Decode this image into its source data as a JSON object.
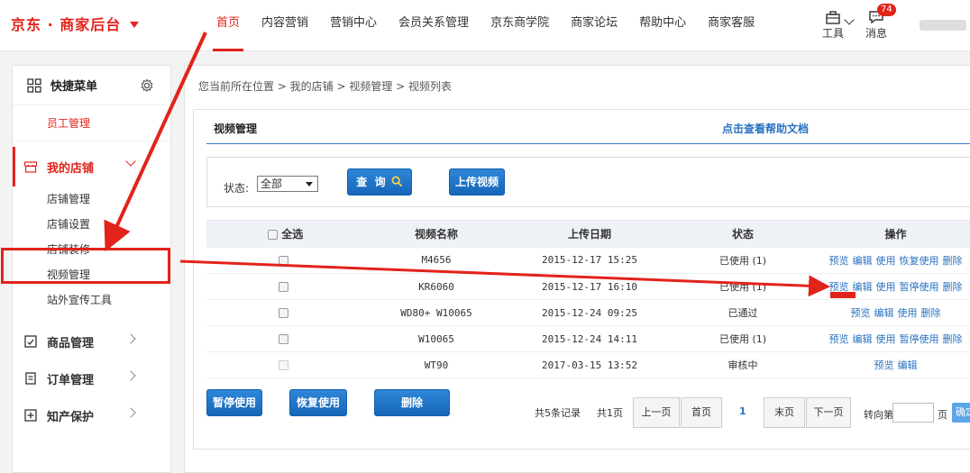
{
  "header": {
    "brand": "京东 · 商家后台",
    "nav": [
      "首页",
      "内容营销",
      "营销中心",
      "会员关系管理",
      "京东商学院",
      "商家论坛",
      "帮助中心",
      "商家客服"
    ],
    "active_nav_index": 0,
    "tools_label": "工具",
    "messages_label": "消息",
    "messages_count": "74"
  },
  "sidebar": {
    "quick_menu": "快捷菜单",
    "staff": "员工管理",
    "my_shop": "我的店铺",
    "shop_items": [
      "店铺管理",
      "店铺设置",
      "店铺装修",
      "视频管理",
      "站外宣传工具"
    ],
    "selected_item": "视频管理",
    "groups": [
      "商品管理",
      "订单管理",
      "知产保护"
    ]
  },
  "breadcrumb": "您当前所在位置 > 我的店铺 > 视频管理 > 视频列表",
  "panel": {
    "title": "视频管理",
    "help_link": "点击查看帮助文档",
    "status_label": "状态:",
    "status_value": "全部",
    "query_button": "查  询",
    "upload_button": "上传视频"
  },
  "table": {
    "select_all": "全选",
    "headers": [
      "视频名称",
      "上传日期",
      "状态",
      "操作"
    ],
    "rows": [
      {
        "name": "M4656",
        "date": "2015-12-17 15:25",
        "status": "已使用 (1)",
        "ops": [
          "预览",
          "编辑",
          "使用",
          "恢复使用",
          "删除"
        ],
        "disabled": false
      },
      {
        "name": "KR6060",
        "date": "2015-12-17 16:10",
        "status": "已使用 (1)",
        "ops": [
          "预览",
          "编辑",
          "使用",
          "暂停使用",
          "删除"
        ],
        "disabled": false
      },
      {
        "name": "WD80+ W10065",
        "date": "2015-12-24 09:25",
        "status": "已通过",
        "ops": [
          "预览",
          "编辑",
          "使用",
          "删除"
        ],
        "disabled": false
      },
      {
        "name": "W10065",
        "date": "2015-12-24 14:11",
        "status": "已使用 (1)",
        "ops": [
          "预览",
          "编辑",
          "使用",
          "暂停使用",
          "删除"
        ],
        "disabled": false
      },
      {
        "name": "WT90",
        "date": "2017-03-15 13:52",
        "status": "审核中",
        "ops": [
          "预览",
          "编辑"
        ],
        "disabled": true
      }
    ]
  },
  "footer": {
    "pause_button": "暂停使用",
    "resume_button": "恢复使用",
    "delete_button": "删除",
    "total_records": "共5条记录",
    "total_pages": "共1页",
    "prev": "上一页",
    "first": "首页",
    "current_page": "1",
    "last": "末页",
    "next": "下一页",
    "goto_label": "转向第",
    "page_unit": "页",
    "confirm": "确定"
  },
  "colors": {
    "brand_red": "#e2231a",
    "link_blue": "#2a72c2",
    "button_blue": "#1567b8"
  }
}
